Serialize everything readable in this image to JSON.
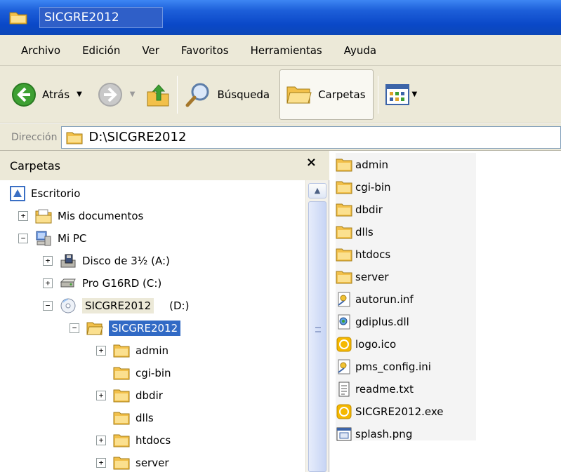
{
  "window": {
    "title": "SICGRE2012"
  },
  "menu": [
    "Archivo",
    "Edición",
    "Ver",
    "Favoritos",
    "Herramientas",
    "Ayuda"
  ],
  "toolbar": {
    "back_label": "Atrás",
    "search_label": "Búsqueda",
    "folders_label": "Carpetas"
  },
  "address": {
    "label": "Dirección",
    "value": "D:\\SICGRE2012"
  },
  "folders_pane": {
    "title": "Carpetas",
    "close": "×",
    "tree": [
      {
        "label": "Escritorio",
        "icon": "desktop-icon",
        "expander": ""
      },
      {
        "label": "Mis documentos",
        "icon": "my-documents-icon",
        "expander": "+"
      },
      {
        "label": "Mi PC",
        "icon": "my-computer-icon",
        "expander": "−"
      },
      {
        "label": "Disco de 3½ (A:)",
        "icon": "floppy-drive-icon",
        "expander": "+"
      },
      {
        "label": "Pro G16RD (C:)",
        "icon": "hard-drive-icon",
        "expander": "+"
      },
      {
        "label": "SICGRE2012",
        "suffix": "(D:)",
        "icon": "cd-drive-icon",
        "expander": "−"
      },
      {
        "label": "SICGRE2012",
        "icon": "folder-open-icon",
        "expander": "−"
      },
      {
        "label": "admin",
        "icon": "folder-icon",
        "expander": "+"
      },
      {
        "label": "cgi-bin",
        "icon": "folder-icon",
        "expander": ""
      },
      {
        "label": "dbdir",
        "icon": "folder-icon",
        "expander": "+"
      },
      {
        "label": "dlls",
        "icon": "folder-icon",
        "expander": ""
      },
      {
        "label": "htdocs",
        "icon": "folder-icon",
        "expander": "+"
      },
      {
        "label": "server",
        "icon": "folder-icon",
        "expander": "+"
      }
    ]
  },
  "files": [
    {
      "name": "admin",
      "icon": "folder-icon"
    },
    {
      "name": "cgi-bin",
      "icon": "folder-icon"
    },
    {
      "name": "dbdir",
      "icon": "folder-icon"
    },
    {
      "name": "dlls",
      "icon": "folder-icon"
    },
    {
      "name": "htdocs",
      "icon": "folder-icon"
    },
    {
      "name": "server",
      "icon": "folder-icon"
    },
    {
      "name": "autorun.inf",
      "icon": "settings-file-icon"
    },
    {
      "name": "gdiplus.dll",
      "icon": "dll-file-icon"
    },
    {
      "name": "logo.ico",
      "icon": "ico-file-icon"
    },
    {
      "name": "pms_config.ini",
      "icon": "settings-file-icon"
    },
    {
      "name": "readme.txt",
      "icon": "text-file-icon"
    },
    {
      "name": "SICGRE2012.exe",
      "icon": "exe-file-icon"
    },
    {
      "name": "splash.png",
      "icon": "image-file-icon"
    }
  ],
  "colors": {
    "selection": "#316ac5",
    "chrome": "#ece9d8",
    "titlebar": "#0a48c8",
    "folder": "#f5c84a"
  }
}
